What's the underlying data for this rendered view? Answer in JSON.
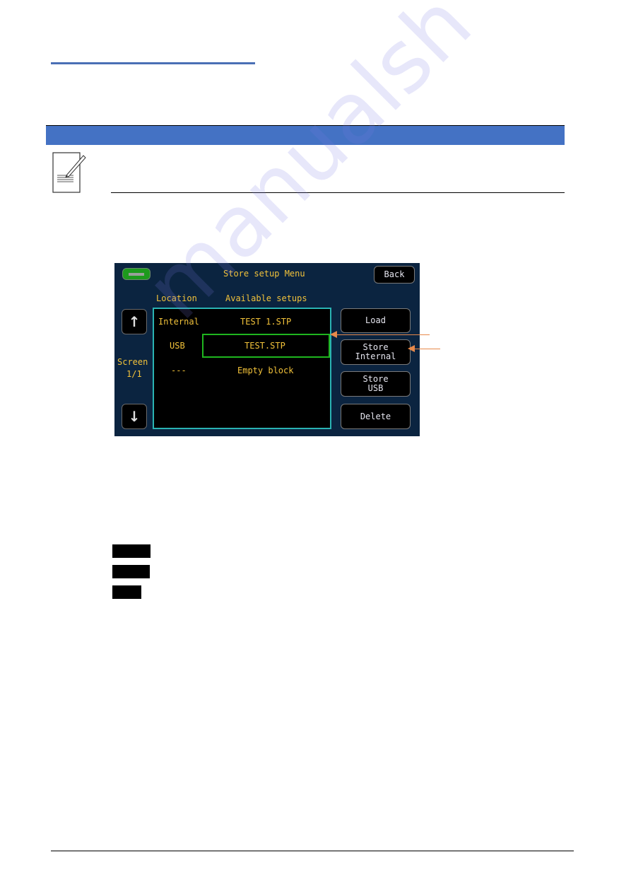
{
  "device_screen": {
    "title": "Store setup Menu",
    "back_label": "Back",
    "status_indicator": "green-status-led",
    "columns": {
      "location": "Location",
      "available": "Available setups"
    },
    "rows": [
      {
        "location": "Internal",
        "setup": "TEST 1.STP",
        "selected": false
      },
      {
        "location": "USB",
        "setup": "TEST.STP",
        "selected": true
      },
      {
        "location": "---",
        "setup": "Empty block",
        "selected": false
      }
    ],
    "pager": {
      "label": "Screen",
      "value": "1/1",
      "up_icon": "arrow-up-icon",
      "down_icon": "arrow-down-icon"
    },
    "buttons": {
      "load": "Load",
      "store_internal_line1": "Store",
      "store_internal_line2": "Internal",
      "store_usb_line1": "Store",
      "store_usb_line2": "USB",
      "delete": "Delete"
    }
  },
  "document": {
    "note_icon": "note-pencil-icon",
    "section_bar_color": "#4472c4",
    "header_rule_color": "#4a6fb5",
    "callout_color": "#e8894a",
    "watermark": "manualsh"
  }
}
